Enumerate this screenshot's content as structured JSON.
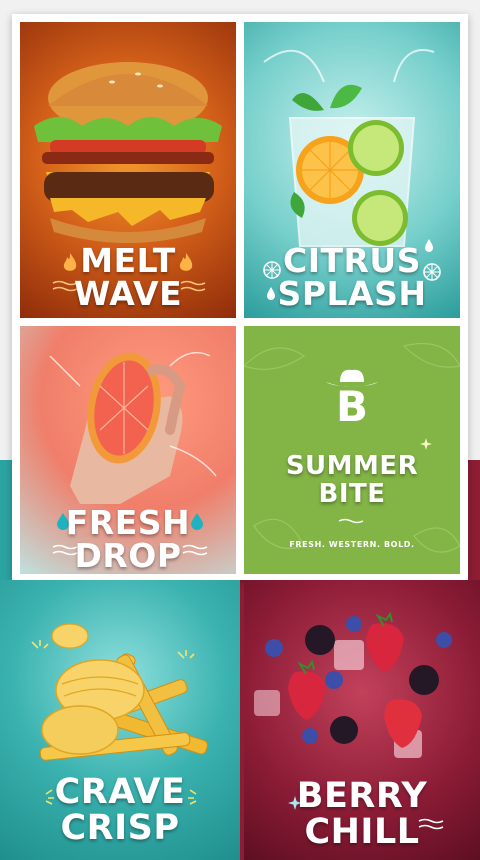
{
  "posters": [
    {
      "line1": "MELT",
      "line2": "WAVE"
    },
    {
      "line1": "CITRUS",
      "line2": "SPLASH"
    },
    {
      "line1": "FRESH",
      "line2": "DROP"
    },
    {
      "line1": "SUMMER",
      "line2": "BITE",
      "tagline": "FRESH. WESTERN. BOLD.",
      "logo_letter": "B"
    },
    {
      "line1": "CRAVE",
      "line2": "CRISP"
    },
    {
      "line1": "BERRY",
      "line2": "CHILL"
    }
  ],
  "colors": {
    "melt_bg": "#d5611a",
    "citrus_bg": "#76cfcb",
    "fresh_bg": "#f07e6a",
    "summer_bg": "#82b446",
    "crave_bg": "#3ab2af",
    "berry_bg": "#8a1b35"
  },
  "icons": [
    "flame-icon",
    "wave-icon",
    "citrus-slice-icon",
    "water-drop-icon",
    "cowboy-hat-icon",
    "sparkle-icon",
    "burst-lines-icon"
  ]
}
